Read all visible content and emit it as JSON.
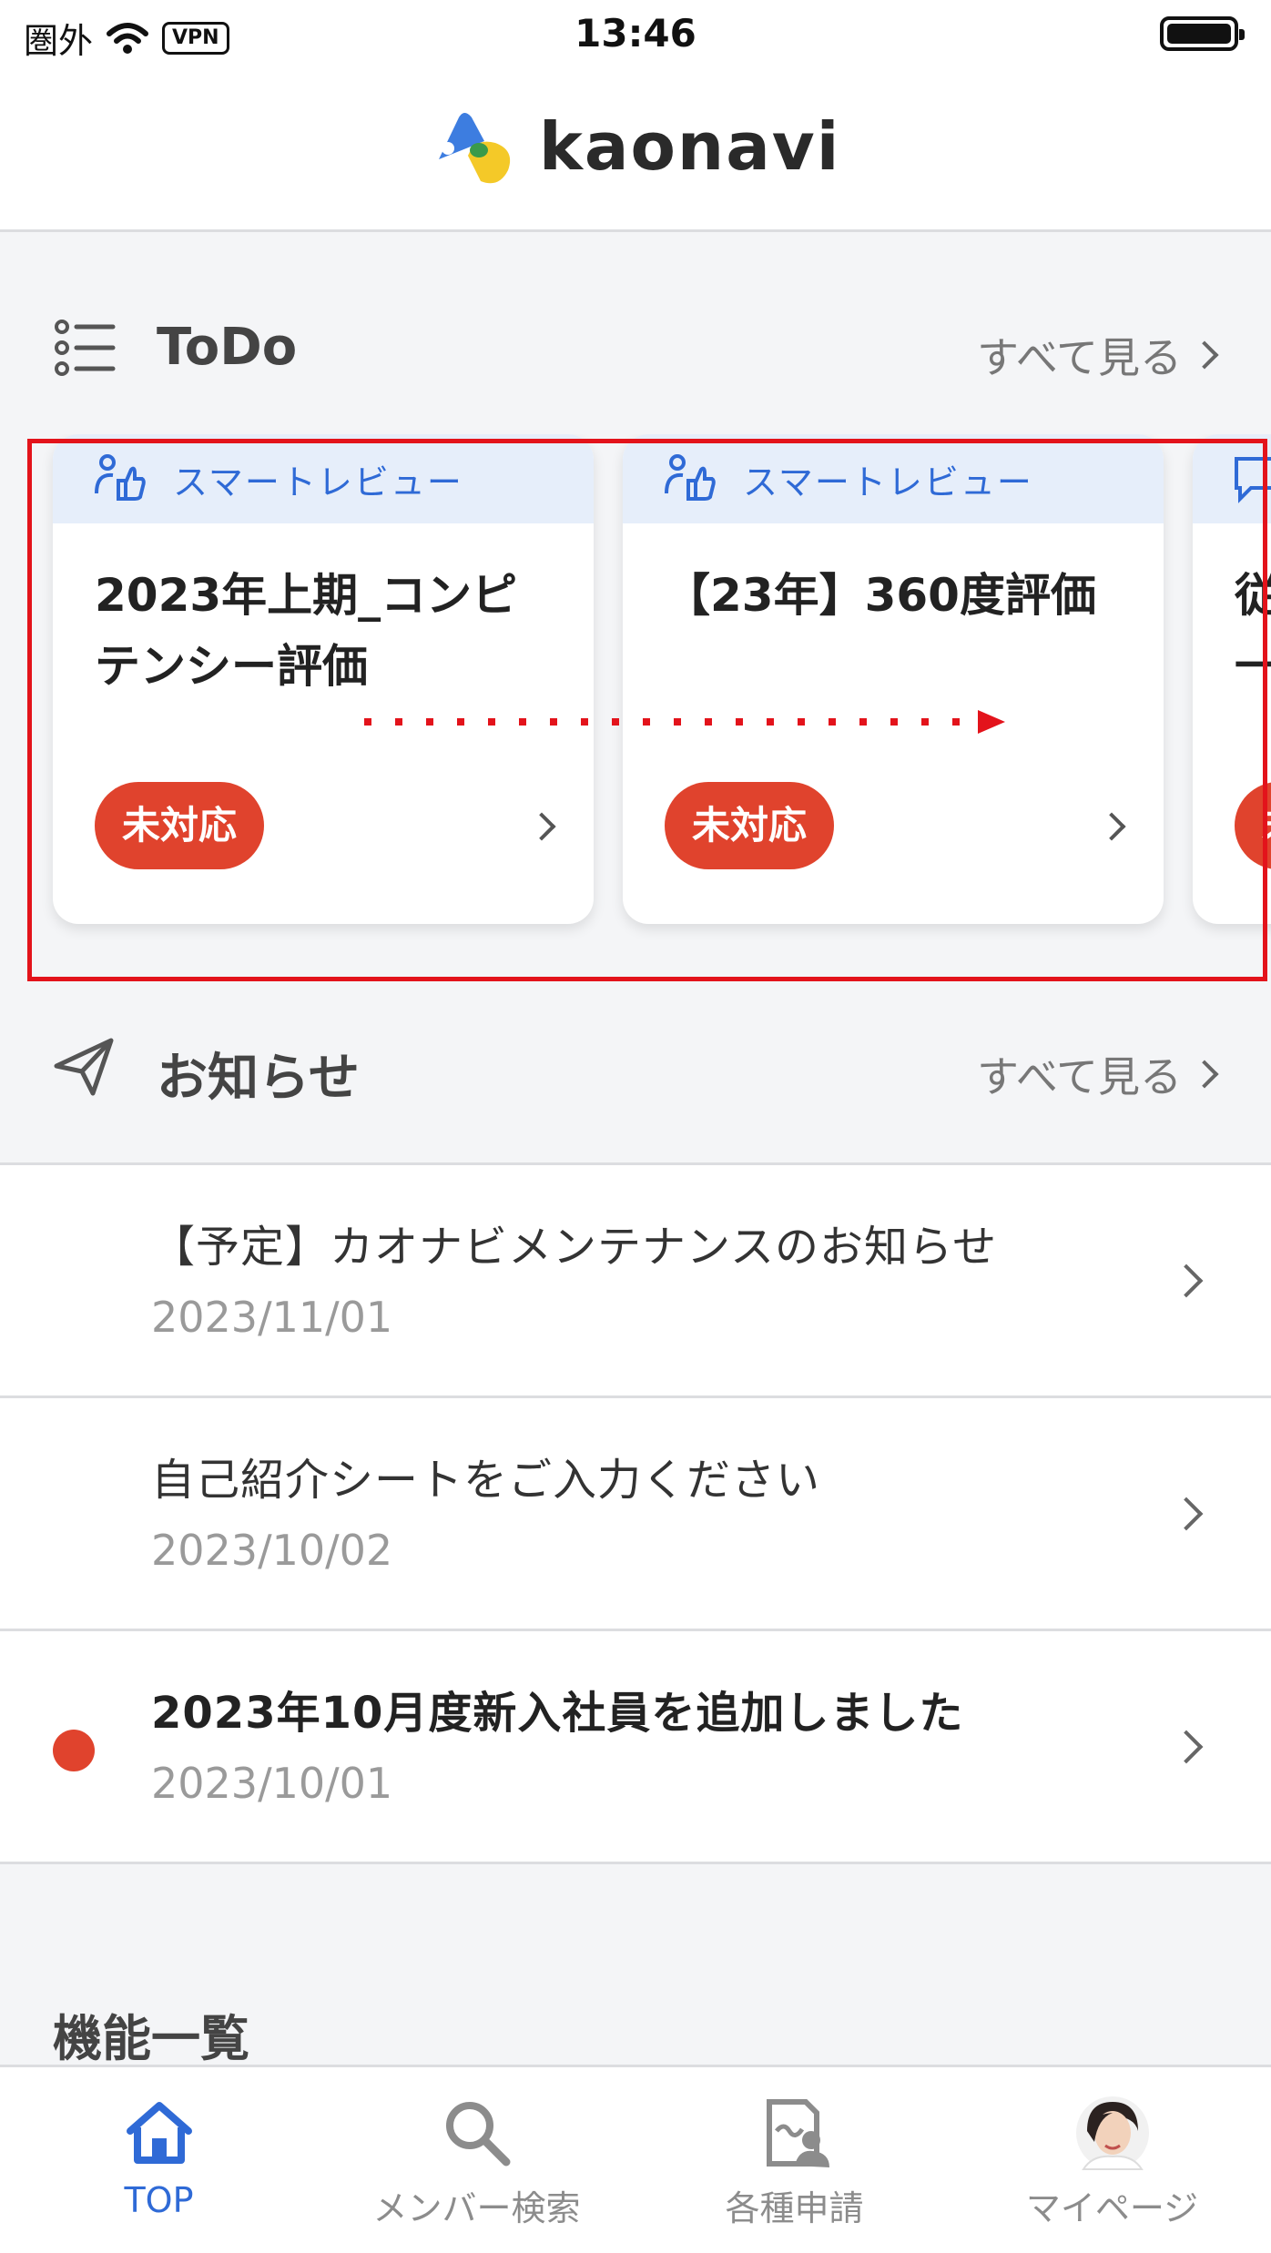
{
  "status_bar": {
    "carrier": "圏外",
    "vpn": "VPN",
    "time": "13:46"
  },
  "header": {
    "logo_text": "kaonavi"
  },
  "todo": {
    "title": "ToDo",
    "see_all": "すべて見る",
    "cards": [
      {
        "category": "スマートレビュー",
        "title": "2023年上期_コンピテンシー評価",
        "status": "未対応"
      },
      {
        "category": "スマートレビュー",
        "title": "【23年】360度評価",
        "status": "未対応"
      },
      {
        "category": "",
        "title": "従\n一",
        "status": "未"
      }
    ]
  },
  "news": {
    "title": "お知らせ",
    "see_all": "すべて見る",
    "items": [
      {
        "title": "【予定】カオナビメンテナンスのお知らせ",
        "date": "2023/11/01",
        "unread": false
      },
      {
        "title": "自己紹介シートをご入力ください",
        "date": "2023/10/02",
        "unread": false
      },
      {
        "title": "2023年10月度新入社員を追加しました",
        "date": "2023/10/01",
        "unread": true
      }
    ]
  },
  "features": {
    "title": "機能一覧"
  },
  "tab_bar": {
    "tabs": [
      {
        "label": "TOP",
        "icon": "home-icon",
        "active": true
      },
      {
        "label": "メンバー検索",
        "icon": "search-icon",
        "active": false
      },
      {
        "label": "各種申請",
        "icon": "application-icon",
        "active": false
      },
      {
        "label": "マイページ",
        "icon": "avatar-icon",
        "active": false
      }
    ]
  },
  "colors": {
    "accent": "#2f6ad6",
    "status_red": "#e0432d",
    "highlight": "#e3131b",
    "background": "#f4f5f7"
  }
}
